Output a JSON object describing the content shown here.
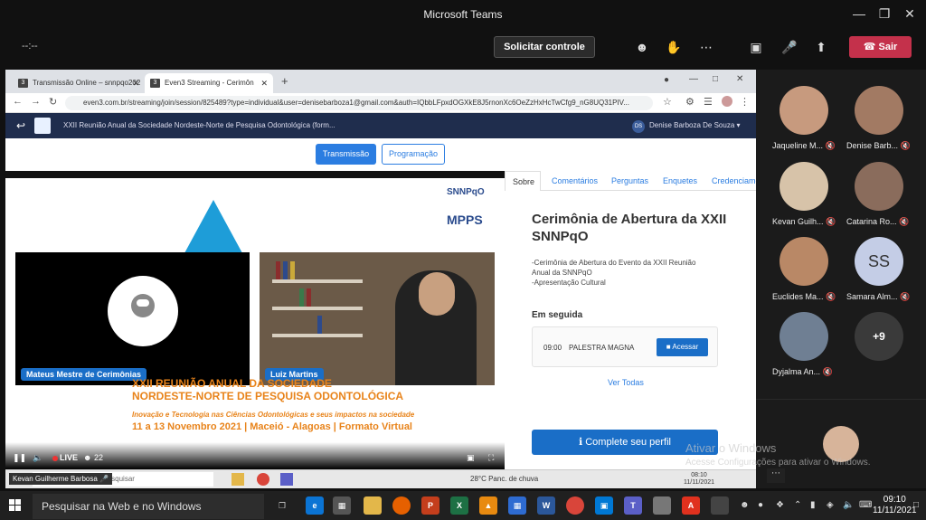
{
  "teams": {
    "title": "Microsoft Teams",
    "timer": "--:--",
    "request_control": "Solicitar controle",
    "leave": "Sair"
  },
  "browser": {
    "tabs": [
      {
        "favicon": "3",
        "label": "Transmissão Online – snnpqo202"
      },
      {
        "favicon": "3",
        "label": "Even3 Streaming - Cerimôn"
      }
    ],
    "url": "even3.com.br/streaming/join/session/825489?type=individual&user=denisebarboza1@gmail.com&auth=IQbbLFpxdOGXkE8J5rnonXc6OeZzHxHcTwCfg9_nG8UQ31PIV..."
  },
  "site": {
    "title": "XXII Reunião Anual da Sociedade Nordeste-Norte de Pesquisa Odontológica (form...",
    "user_initials": "DS",
    "user_name": "Denise Barboza De Souza",
    "btn_transmission": "Transmissão",
    "btn_program": "Programação"
  },
  "video": {
    "logo1": "SNNPqO",
    "logo2": "MPPS",
    "speaker1": "Mateus Mestre de Cerimônias",
    "speaker2": "Luiz Martins",
    "event_line1": "XXII REUNIÃO ANUAL DA SOCIEDADE",
    "event_line2": "NORDESTE-NORTE DE PESQUISA ODONTOLÓGICA",
    "event_sub": "Inovação e Tecnologia nas Ciências Odontológicas e seus impactos na sociedade",
    "event_date": "11 a 13 Novembro 2021 | Maceió - Alagoas | Formato Virtual",
    "live": "LIVE",
    "viewers": "22"
  },
  "panel": {
    "tabs": [
      "Sobre",
      "Comentários",
      "Perguntas",
      "Enquetes",
      "Credenciamento"
    ],
    "title": "Cerimônia de Abertura da XXII SNNPqO",
    "desc1": "-Cerimônia de Abertura do Evento da XXII Reunião",
    "desc2": "Anual da SNNPqO",
    "desc3": "-Apresentação Cultural",
    "next_heading": "Em seguida",
    "next_time": "09:00",
    "next_name": "PALESTRA MAGNA",
    "next_btn": "Acessar",
    "see_all": "Ver Todas",
    "profile_btn": "Complete seu perfil"
  },
  "inner_taskbar": {
    "presenter": "Kevan Guilherme Barbosa",
    "search": "Digite aqui para pesquisar",
    "weather": "28°C  Panc. de chuva",
    "time": "08:10",
    "date": "11/11/2021"
  },
  "participants": [
    {
      "name": "Jaqueline M...",
      "color": "#c79a7e"
    },
    {
      "name": "Denise Barb...",
      "color": "#a27a63"
    },
    {
      "name": "Kevan Guilh...",
      "color": "#d7c3a9"
    },
    {
      "name": "Catarina Ro...",
      "color": "#8a6c5c"
    },
    {
      "name": "Euclides Ma...",
      "color": "#b98866"
    },
    {
      "name": "Samara Alm...",
      "initials": "SS"
    },
    {
      "name": "Dyjalma An...",
      "color": "#6f7f93"
    },
    {
      "more": "+9"
    }
  ],
  "watermark": {
    "line1": "Ativar o Windows",
    "line2": "Acesse Configurações para ativar o Windows."
  },
  "win_taskbar": {
    "search": "Pesquisar na Web e no Windows",
    "time": "09:10",
    "date": "11/11/2021"
  }
}
